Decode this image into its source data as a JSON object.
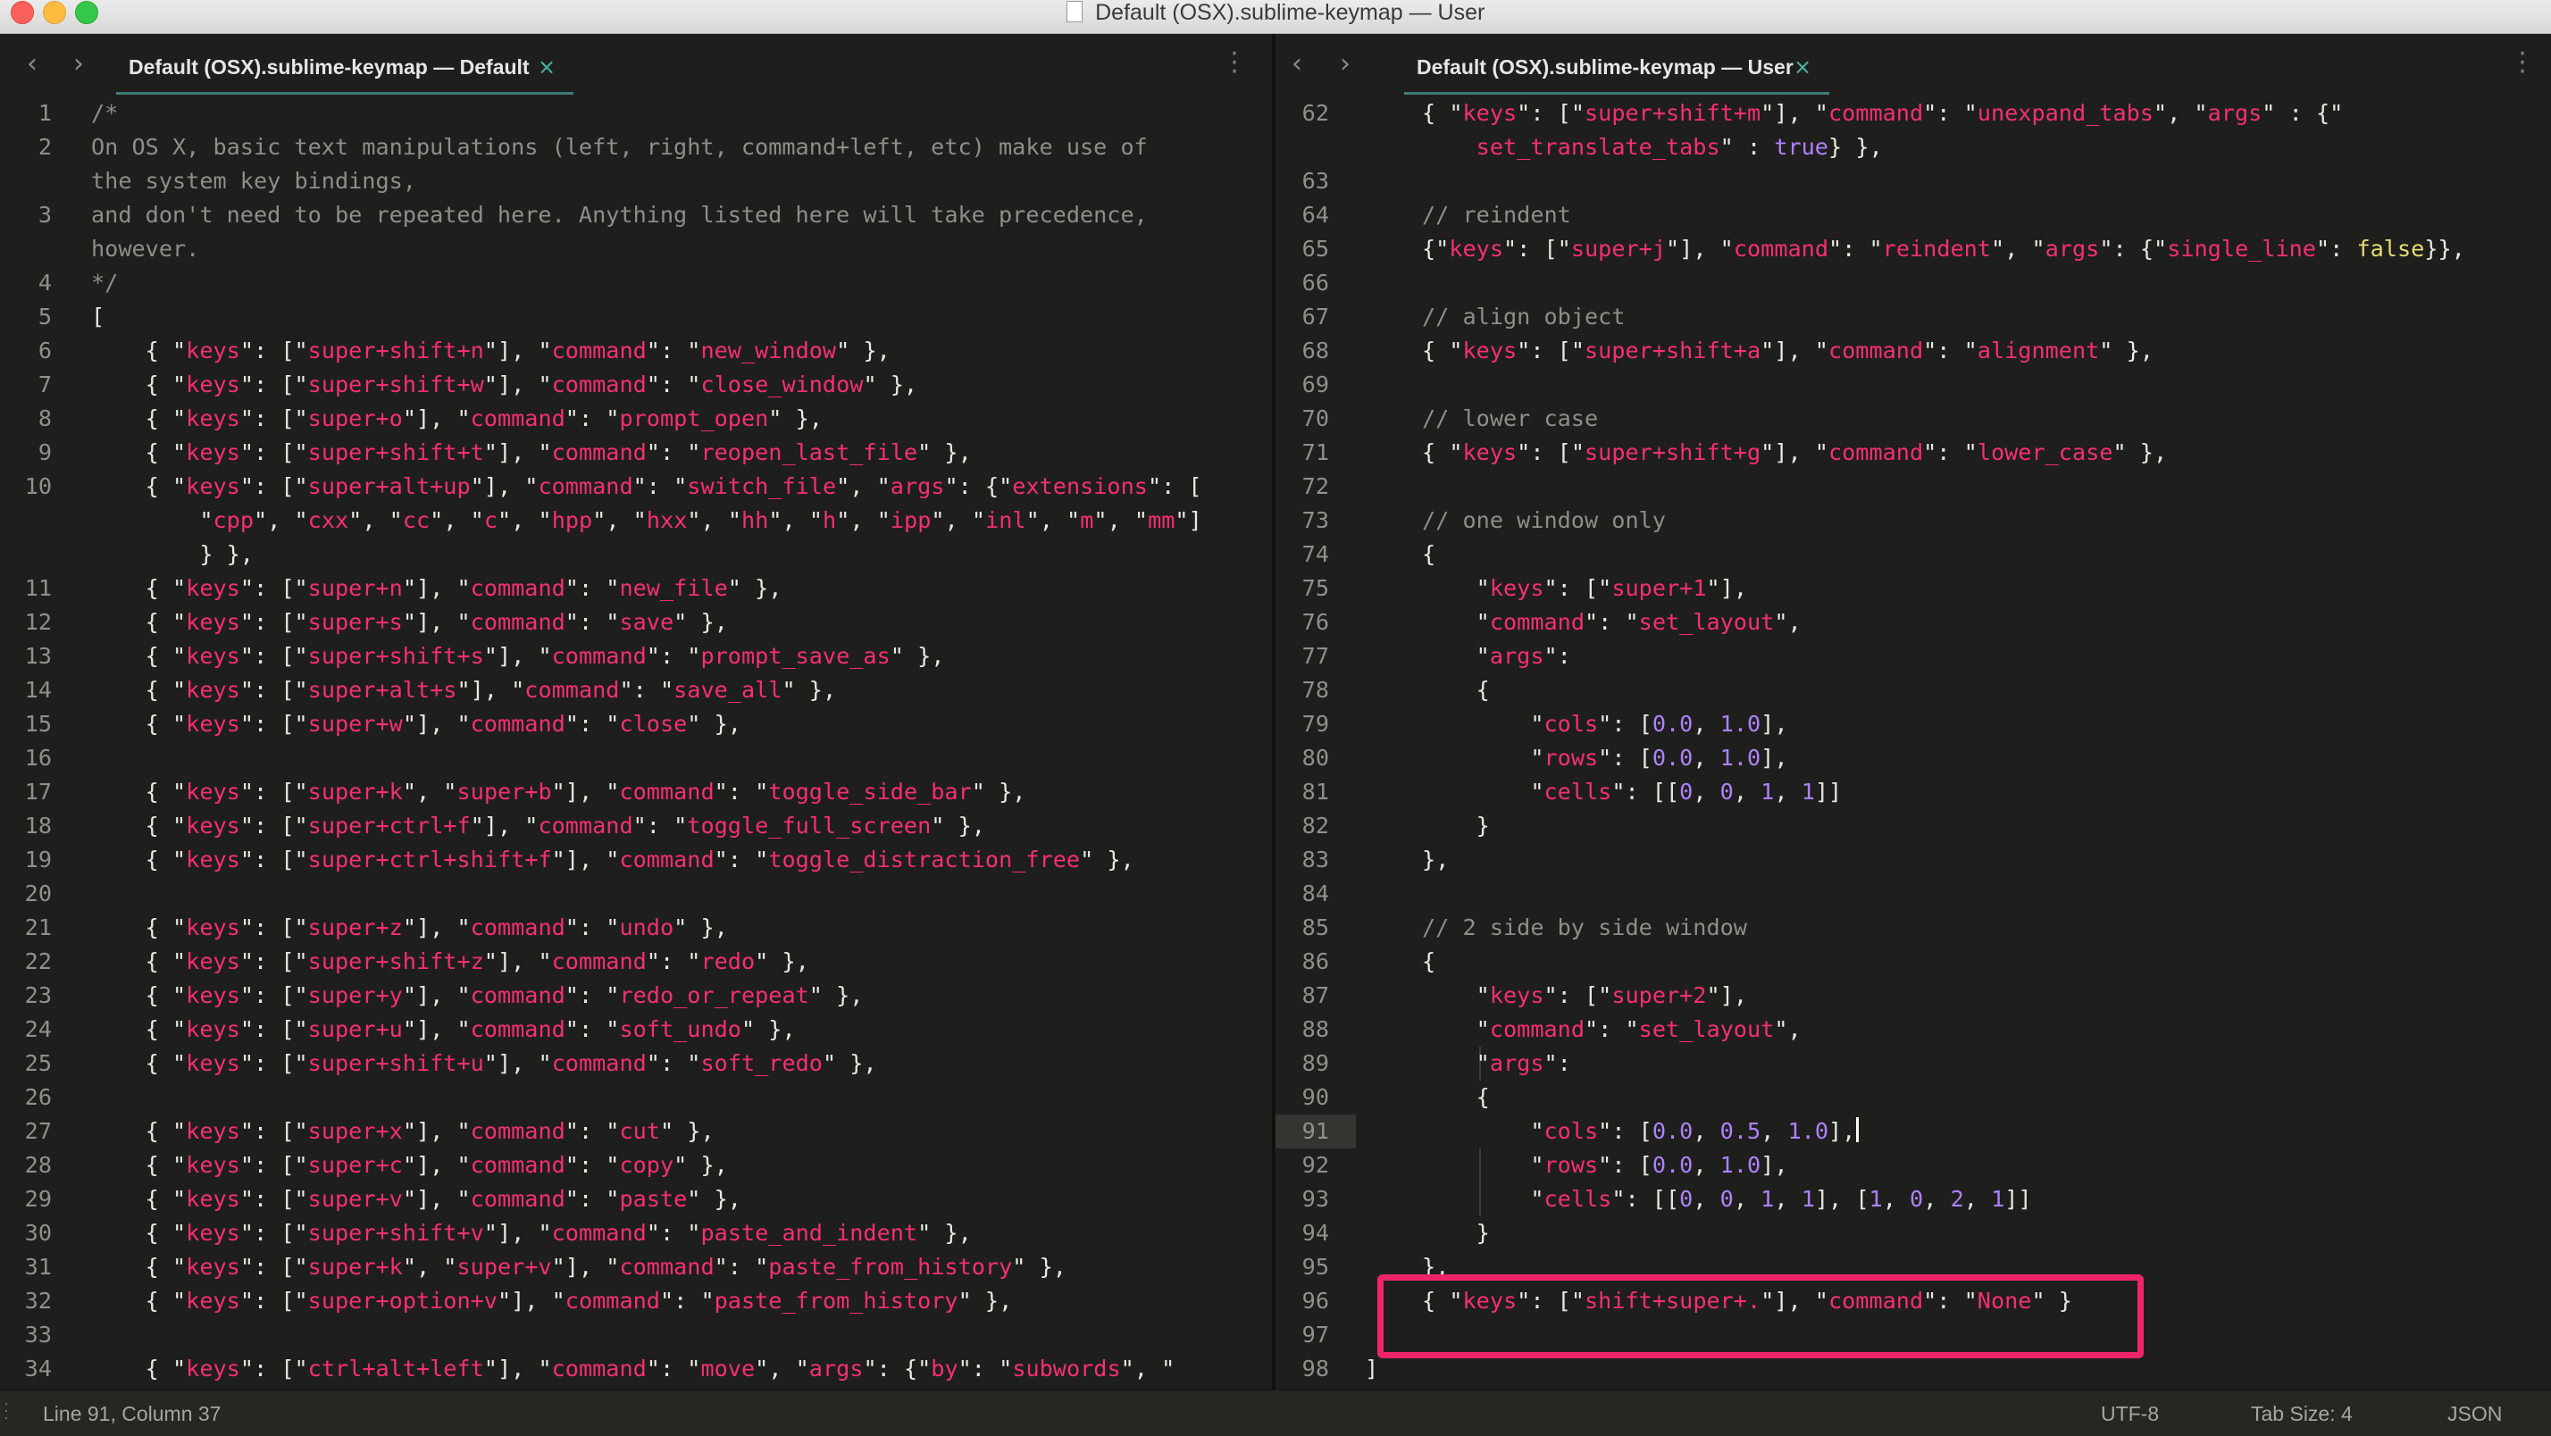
{
  "window": {
    "title": "Default (OSX).sublime-keymap — User"
  },
  "left_pane": {
    "tab_label": "Default (OSX).sublime-keymap — Default",
    "line_numbers": "1\n2\n\n3\n\n4\n5\n6\n7\n8\n9\n10\n\n\n11\n12\n13\n14\n15\n16\n17\n18\n19\n20\n21\n22\n23\n24\n25\n26\n27\n28\n29\n30\n31\n32\n33\n34"
  },
  "right_pane": {
    "tab_label": "Default (OSX).sublime-keymap — User",
    "line_numbers": "62\n\n63\n64\n65\n66\n67\n68\n69\n70\n71\n72\n73\n74\n75\n76\n77\n78\n79\n80\n81\n82\n83\n84\n85\n86\n87\n88\n89\n90\n91\n92\n93\n94\n95\n96\n97\n98",
    "active_line": "91"
  },
  "status_bar": {
    "position": "Line 91, Column 37",
    "encoding": "UTF-8",
    "tab_size": "Tab Size: 4",
    "syntax": "JSON"
  },
  "icons": {
    "nav_back": "chevron-left-icon",
    "nav_forward": "chevron-right-icon",
    "tab_close": "close-icon",
    "pane_menu": "vertical-dots-icon",
    "document": "document-icon"
  },
  "colors": {
    "editor_bg": "#1e1f1c",
    "keyword_pink": "#f62f72",
    "string_yellow": "#e6db74",
    "comment_gray": "#8d8e87",
    "constant_purple": "#ae81ff",
    "tab_accent": "#4bb3a9",
    "highlight_box": "#f0246b"
  }
}
